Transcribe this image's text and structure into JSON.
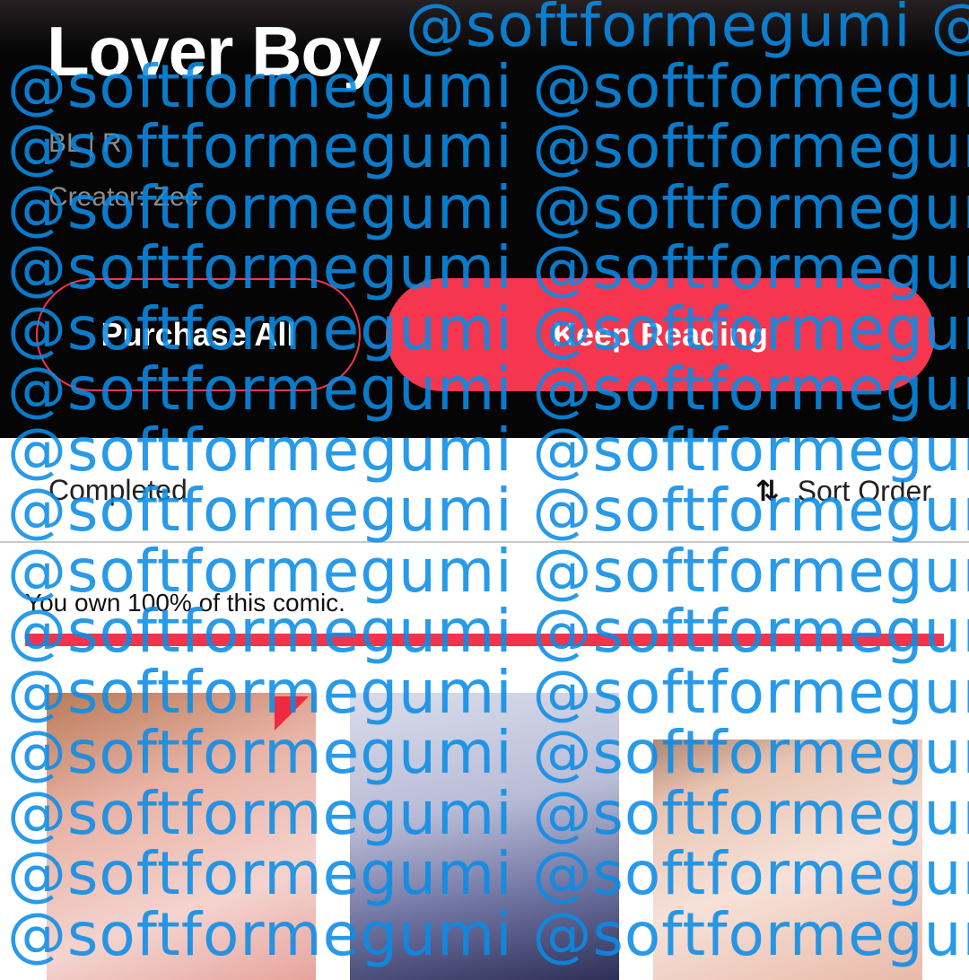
{
  "header": {
    "title": "Lover Boy",
    "genre": "BL | R",
    "creator": "Creator: Zec",
    "purchase_all_label": "Purchase All",
    "keep_reading_label": "Keep Reading"
  },
  "status": {
    "label": "Completed",
    "sort_icon": "sort-arrows-icon",
    "sort_glyph": "⇅",
    "sort_label": "Sort Order"
  },
  "ownership": {
    "text": "You own 100% of this comic.",
    "percent": 100
  },
  "episodes": [
    {
      "name": "episode-thumbnail-1",
      "new_badge": true
    },
    {
      "name": "episode-thumbnail-2",
      "new_badge": false
    },
    {
      "name": "episode-thumbnail-3",
      "new_badge": false
    }
  ],
  "colors": {
    "accent": "#f5364e",
    "header_bg": "#050505",
    "watermark": "#0a8ce6"
  },
  "watermark": {
    "lines": [
      "@softformegumi @s",
      "@softformegumi @softformegumi",
      "@softformegumi @softformegumi",
      "@softformegumi @softformegumi",
      "@softformegumi @softformegumi",
      "@softformegumi @softformegumi",
      "@softformegumi @softformegumi",
      "@softformegumi @softformegumi",
      "@softformegumi @softformegumi",
      "@softformegumi @softformegumi",
      "@softformegumi @softformegumi",
      "@softformegumi @softformegumi",
      "@softformegumi @softformegumi",
      "@softformegumi @softformegumi",
      "@softformegumi @softformegumi",
      "@softformegumi @softformegumi"
    ]
  }
}
